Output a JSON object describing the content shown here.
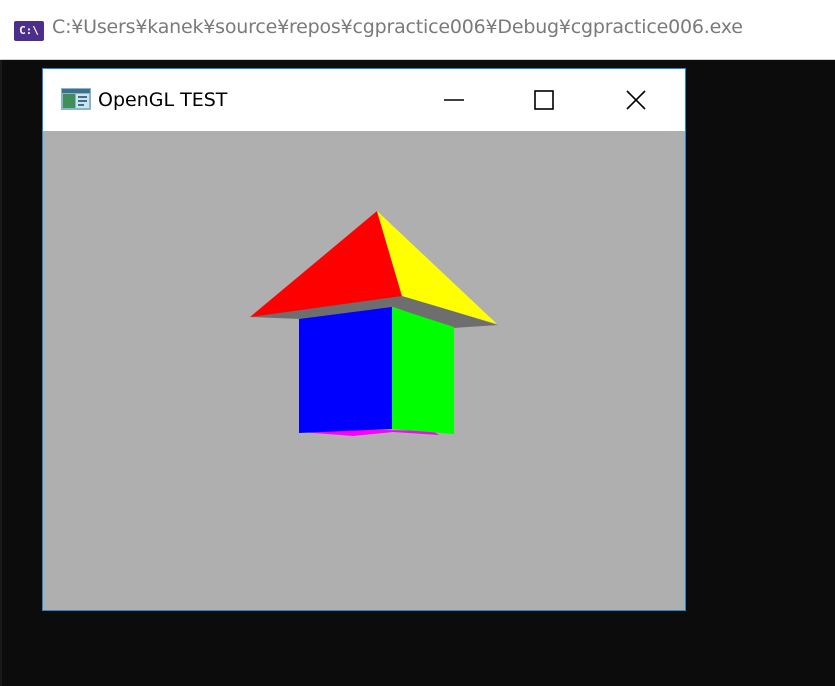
{
  "console": {
    "icon_label": "C:\\",
    "title": "C:¥Users¥kanek¥source¥repos¥cgpractice006¥Debug¥cgpractice006.exe"
  },
  "gl_window": {
    "title": "OpenGL TEST",
    "buttons": {
      "minimize": "minimize-icon",
      "maximize": "maximize-icon",
      "close": "close-icon"
    },
    "canvas_color": "#afafaf",
    "scene": {
      "object": "house",
      "roof_colors": [
        "#ff0000",
        "#ffff00"
      ],
      "eave_color": "#6e6e6e",
      "wall_colors": [
        "#0000ff",
        "#00ff00"
      ],
      "floor_color": "#ff00ff"
    }
  },
  "colors": {
    "console_bg": "#0c0c0c",
    "window_border": "#2a84d6",
    "titlebar_bg": "#ffffff"
  }
}
